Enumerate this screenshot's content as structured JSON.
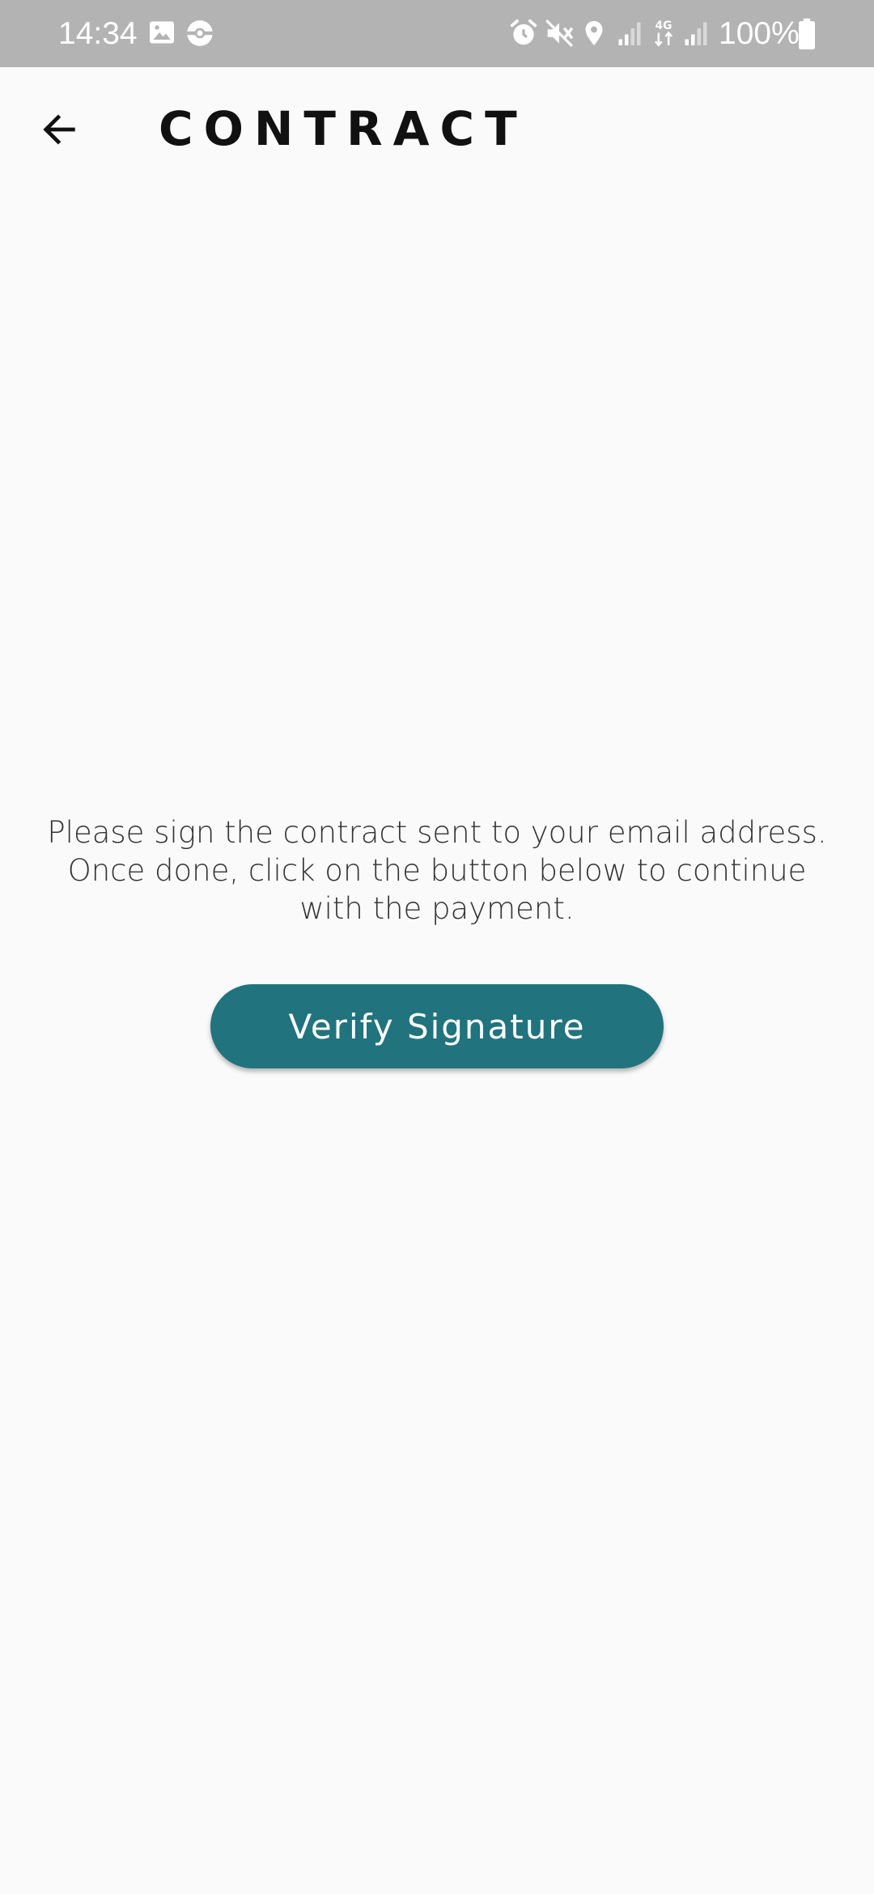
{
  "status_bar": {
    "time": "14:34",
    "battery": "100%",
    "icons": [
      "gallery-icon",
      "sync-icon",
      "alarm-icon",
      "mute-icon",
      "location-icon",
      "signal-icon",
      "4g-icon",
      "signal-icon",
      "battery-icon"
    ]
  },
  "app_bar": {
    "title": "CONTRACT",
    "back_icon": "arrow-back-icon"
  },
  "main": {
    "instructions": "Please sign the contract sent to your email address. Once done, click on the button below to continue with the payment.",
    "verify_button_label": "Verify Signature"
  },
  "colors": {
    "accent": "#21737e",
    "status_bar_bg": "#b3b3b3",
    "background": "#fafafa"
  }
}
